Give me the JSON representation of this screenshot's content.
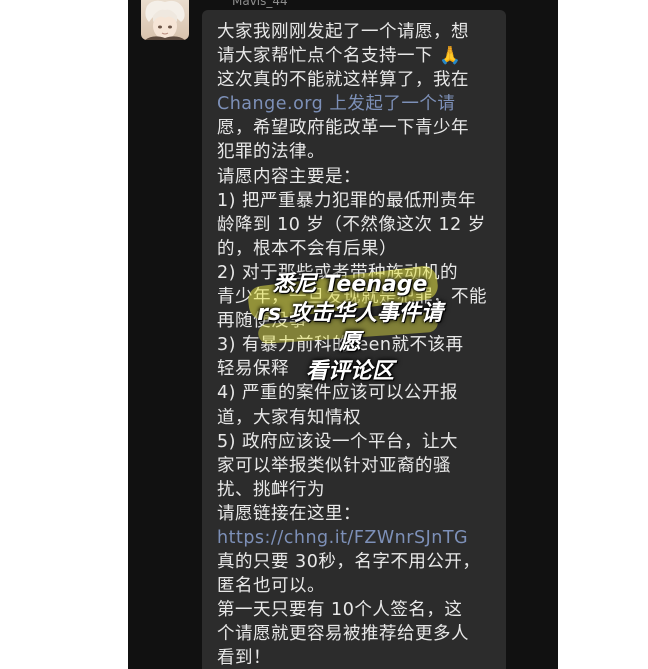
{
  "chat": {
    "sender_name": "Mavis_44",
    "message_lines": [
      "大家我刚刚发起了一个请愿，想",
      "请大家帮忙点个名支持一下 🙏",
      "这次真的不能就这样算了，我在",
      " Change.org 上发起了一个请",
      "愿，希望政府能改革一下青少年",
      "犯罪的法律。",
      "请愿内容主要是：",
      "1) 把严重暴力犯罪的最低刑责年",
      "龄降到 10 岁（不然像这次 12 岁",
      "的，根本不会有后果）",
      "2) 对于那些或者带种族动机的",
      "青少年，一旦发现就是犯罪，不能",
      "再随便没事",
      "3) 有暴力前科的teen就不该再",
      "轻易保释",
      "4) 严重的案件应该可以公开报",
      "道，大家有知情权",
      "5) 政府应该设一个平台，让大",
      "家可以举报类似针对亚裔的骚",
      "扰、挑衅行为",
      "请愿链接在这里：",
      "https://chng.it/FZWnrSJnTG",
      "真的只要 30秒，名字不用公开，",
      "匿名也可以。",
      "第一天只要有 10个人签名，这",
      "个请愿就更容易被推荐给更多人",
      "看到！"
    ],
    "link_text": "https://chng.it/FZWnrSJnTG",
    "site_text": "Change.org"
  },
  "overlay": {
    "lines": [
      "悉尼 Teenage",
      "rs 攻击华人事件请",
      "愿",
      "看评论区"
    ],
    "highlight_color": "#e8e646"
  },
  "colors": {
    "chat_background": "#111111",
    "bubble": "#2c2c2c",
    "text": "#e8e8e8",
    "link": "#7d90b8",
    "page_background": "#ffffff"
  }
}
